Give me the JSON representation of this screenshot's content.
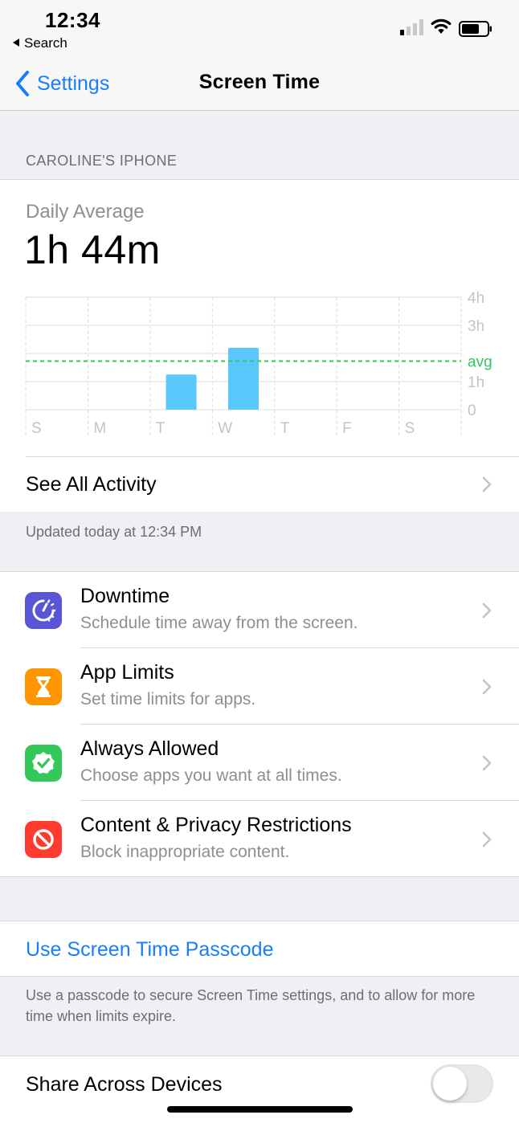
{
  "status_bar": {
    "time": "12:34",
    "back_app": "Search"
  },
  "nav": {
    "back_label": "Settings",
    "title": "Screen Time"
  },
  "device_header": "CAROLINE'S IPHONE",
  "summary": {
    "label": "Daily Average",
    "value": "1h 44m"
  },
  "chart_data": {
    "type": "bar",
    "categories": [
      "S",
      "M",
      "T",
      "W",
      "T",
      "F",
      "S"
    ],
    "values": [
      0,
      0,
      1.25,
      2.2,
      0,
      0,
      0
    ],
    "y_unit": "hours",
    "ylim": [
      0,
      4
    ],
    "y_ticks": [
      "0",
      "1h",
      "avg",
      "3h",
      "4h"
    ],
    "average": 1.73,
    "average_label": "avg",
    "bar_color": "#5ac8fa",
    "avg_color": "#34c759",
    "grid": true
  },
  "see_all": {
    "label": "See All Activity"
  },
  "updated_note": "Updated today at 12:34 PM",
  "features": [
    {
      "title": "Downtime",
      "subtitle": "Schedule time away from the screen.",
      "icon": "downtime-icon",
      "color": "#5856d6"
    },
    {
      "title": "App Limits",
      "subtitle": "Set time limits for apps.",
      "icon": "hourglass-icon",
      "color": "#ff9500"
    },
    {
      "title": "Always Allowed",
      "subtitle": "Choose apps you want at all times.",
      "icon": "checkmark-badge-icon",
      "color": "#34c759"
    },
    {
      "title": "Content & Privacy Restrictions",
      "subtitle": "Block inappropriate content.",
      "icon": "prohibited-icon",
      "color": "#ff3b30"
    }
  ],
  "passcode": {
    "label": "Use Screen Time Passcode",
    "note": "Use a passcode to secure Screen Time settings, and to allow for more time when limits expire."
  },
  "share": {
    "label": "Share Across Devices",
    "enabled": false
  },
  "colors": {
    "accent": "#1a7ef5",
    "background": "#efeff4"
  }
}
